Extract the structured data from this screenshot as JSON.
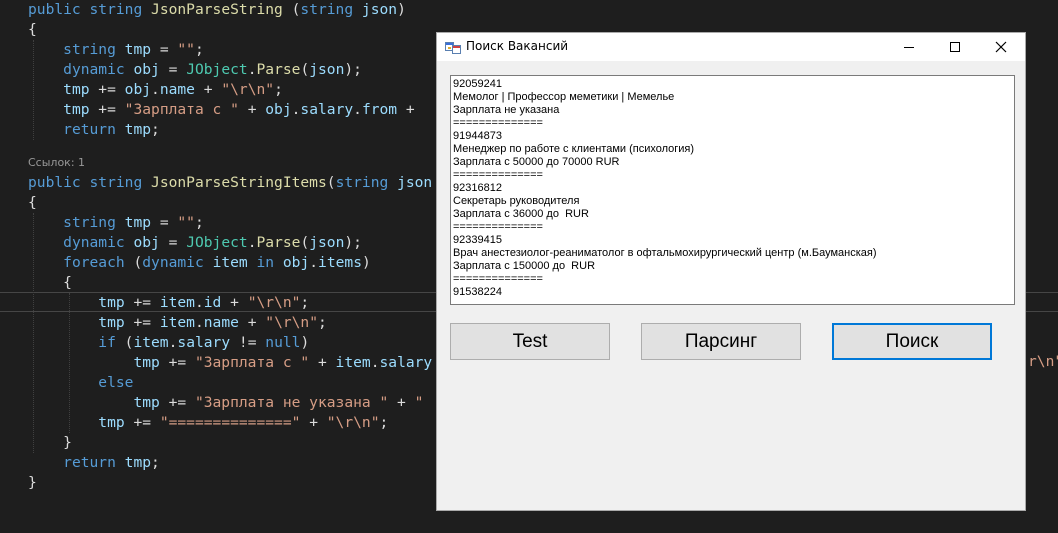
{
  "editor": {
    "lines": [
      [
        {
          "t": "public",
          "c": "kw"
        },
        {
          "t": " "
        },
        {
          "t": "string",
          "c": "kw"
        },
        {
          "t": " "
        },
        {
          "t": "JsonParseString",
          "c": "me"
        },
        {
          "t": " ("
        },
        {
          "t": "string",
          "c": "kw"
        },
        {
          "t": " "
        },
        {
          "t": "json",
          "c": "id"
        },
        {
          "t": ")"
        }
      ],
      [
        {
          "t": "{"
        }
      ],
      [
        {
          "t": "    "
        },
        {
          "t": "string",
          "c": "kw"
        },
        {
          "t": " "
        },
        {
          "t": "tmp",
          "c": "id"
        },
        {
          "t": " = "
        },
        {
          "t": "\"\"",
          "c": "st"
        },
        {
          "t": ";"
        }
      ],
      [
        {
          "t": "    "
        },
        {
          "t": "dynamic",
          "c": "kw"
        },
        {
          "t": " "
        },
        {
          "t": "obj",
          "c": "id"
        },
        {
          "t": " = "
        },
        {
          "t": "JObject",
          "c": "ty"
        },
        {
          "t": "."
        },
        {
          "t": "Parse",
          "c": "me"
        },
        {
          "t": "("
        },
        {
          "t": "json",
          "c": "id"
        },
        {
          "t": ");"
        }
      ],
      [
        {
          "t": "    "
        },
        {
          "t": "tmp",
          "c": "id"
        },
        {
          "t": " += "
        },
        {
          "t": "obj",
          "c": "id"
        },
        {
          "t": "."
        },
        {
          "t": "name",
          "c": "id"
        },
        {
          "t": " + "
        },
        {
          "t": "\"\\r\\n\"",
          "c": "st"
        },
        {
          "t": ";"
        }
      ],
      [
        {
          "t": "    "
        },
        {
          "t": "tmp",
          "c": "id"
        },
        {
          "t": " += "
        },
        {
          "t": "\"Зарплата с \"",
          "c": "st"
        },
        {
          "t": " + "
        },
        {
          "t": "obj",
          "c": "id"
        },
        {
          "t": "."
        },
        {
          "t": "salary",
          "c": "id"
        },
        {
          "t": "."
        },
        {
          "t": "from",
          "c": "id"
        },
        {
          "t": " + "
        }
      ],
      [
        {
          "t": "    "
        },
        {
          "t": "return",
          "c": "kw"
        },
        {
          "t": " "
        },
        {
          "t": "tmp",
          "c": "id"
        },
        {
          "t": ";"
        }
      ],
      [],
      [
        {
          "t": "public",
          "c": "kw"
        },
        {
          "t": " "
        },
        {
          "t": "string",
          "c": "kw"
        },
        {
          "t": " "
        },
        {
          "t": "JsonParseStringItems",
          "c": "me"
        },
        {
          "t": "("
        },
        {
          "t": "string",
          "c": "kw"
        },
        {
          "t": " "
        },
        {
          "t": "json",
          "c": "id"
        }
      ],
      [
        {
          "t": "{"
        }
      ],
      [
        {
          "t": "    "
        },
        {
          "t": "string",
          "c": "kw"
        },
        {
          "t": " "
        },
        {
          "t": "tmp",
          "c": "id"
        },
        {
          "t": " = "
        },
        {
          "t": "\"\"",
          "c": "st"
        },
        {
          "t": ";"
        }
      ],
      [
        {
          "t": "    "
        },
        {
          "t": "dynamic",
          "c": "kw"
        },
        {
          "t": " "
        },
        {
          "t": "obj",
          "c": "id"
        },
        {
          "t": " = "
        },
        {
          "t": "JObject",
          "c": "ty"
        },
        {
          "t": "."
        },
        {
          "t": "Parse",
          "c": "me"
        },
        {
          "t": "("
        },
        {
          "t": "json",
          "c": "id"
        },
        {
          "t": ");"
        }
      ],
      [
        {
          "t": "    "
        },
        {
          "t": "foreach",
          "c": "kw"
        },
        {
          "t": " ("
        },
        {
          "t": "dynamic",
          "c": "kw"
        },
        {
          "t": " "
        },
        {
          "t": "item",
          "c": "id"
        },
        {
          "t": " "
        },
        {
          "t": "in",
          "c": "kw"
        },
        {
          "t": " "
        },
        {
          "t": "obj",
          "c": "id"
        },
        {
          "t": "."
        },
        {
          "t": "items",
          "c": "id"
        },
        {
          "t": ")"
        }
      ],
      [
        {
          "t": "    {"
        }
      ],
      [
        {
          "t": "        "
        },
        {
          "t": "tmp",
          "c": "id"
        },
        {
          "t": " += "
        },
        {
          "t": "item",
          "c": "id"
        },
        {
          "t": "."
        },
        {
          "t": "id",
          "c": "id"
        },
        {
          "t": " + "
        },
        {
          "t": "\"\\r\\n\"",
          "c": "st"
        },
        {
          "t": ";"
        }
      ],
      [
        {
          "t": "        "
        },
        {
          "t": "tmp",
          "c": "id"
        },
        {
          "t": " += "
        },
        {
          "t": "item",
          "c": "id"
        },
        {
          "t": "."
        },
        {
          "t": "name",
          "c": "id"
        },
        {
          "t": " + "
        },
        {
          "t": "\"\\r\\n\"",
          "c": "st"
        },
        {
          "t": ";"
        }
      ],
      [
        {
          "t": "        "
        },
        {
          "t": "if",
          "c": "kw"
        },
        {
          "t": " ("
        },
        {
          "t": "item",
          "c": "id"
        },
        {
          "t": "."
        },
        {
          "t": "salary",
          "c": "id"
        },
        {
          "t": " != "
        },
        {
          "t": "null",
          "c": "kw"
        },
        {
          "t": ")"
        }
      ],
      [
        {
          "t": "            "
        },
        {
          "t": "tmp",
          "c": "id"
        },
        {
          "t": " += "
        },
        {
          "t": "\"Зарплата с \"",
          "c": "st"
        },
        {
          "t": " + "
        },
        {
          "t": "item",
          "c": "id"
        },
        {
          "t": "."
        },
        {
          "t": "salary",
          "c": "id"
        }
      ],
      [
        {
          "t": "        "
        },
        {
          "t": "else",
          "c": "kw"
        }
      ],
      [
        {
          "t": "            "
        },
        {
          "t": "tmp",
          "c": "id"
        },
        {
          "t": " += "
        },
        {
          "t": "\"Зарплата не указана \"",
          "c": "st"
        },
        {
          "t": " + "
        },
        {
          "t": "\"",
          "c": "st"
        }
      ],
      [
        {
          "t": "        "
        },
        {
          "t": "tmp",
          "c": "id"
        },
        {
          "t": " += "
        },
        {
          "t": "\"==============\"",
          "c": "st"
        },
        {
          "t": " + "
        },
        {
          "t": "\"\\r\\n\"",
          "c": "st"
        },
        {
          "t": ";"
        }
      ],
      [
        {
          "t": "    }"
        }
      ],
      [
        {
          "t": "    "
        },
        {
          "t": "return",
          "c": "kw"
        },
        {
          "t": " "
        },
        {
          "t": "tmp",
          "c": "id"
        },
        {
          "t": ";"
        }
      ],
      [
        {
          "t": "}"
        }
      ]
    ],
    "codelens": "Ссылок: 1",
    "right_fragment": "r\\n\""
  },
  "window": {
    "title": "Поиск Вакансий",
    "textbox_lines": [
      "92059241",
      "Мемолог | Профессор меметики | Мемелье",
      "Зарплата не указана",
      "==============",
      "91944873",
      "Менеджер по работе с клиентами (психология)",
      "Зарплата с 50000 до 70000 RUR",
      "==============",
      "92316812",
      "Секретарь руководителя",
      "Зарплата с 36000 до  RUR",
      "==============",
      "92339415",
      "Врач анестезиолог-реаниматолог в офтальмохирургический центр (м.Бауманская)",
      "Зарплата с 150000 до  RUR",
      "==============",
      "91538224"
    ],
    "buttons": {
      "test": "Test",
      "parse": "Парсинг",
      "search": "Поиск"
    }
  }
}
